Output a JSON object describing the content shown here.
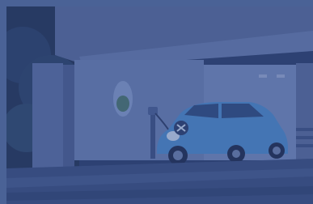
{
  "image": {
    "subject": "electric-car-charging-in-garage",
    "colors": {
      "frame": "#4a6296",
      "tint": "#304682",
      "car_body": "#4f8fd0",
      "wall": "#6f86b8",
      "trees": "#233553"
    }
  }
}
